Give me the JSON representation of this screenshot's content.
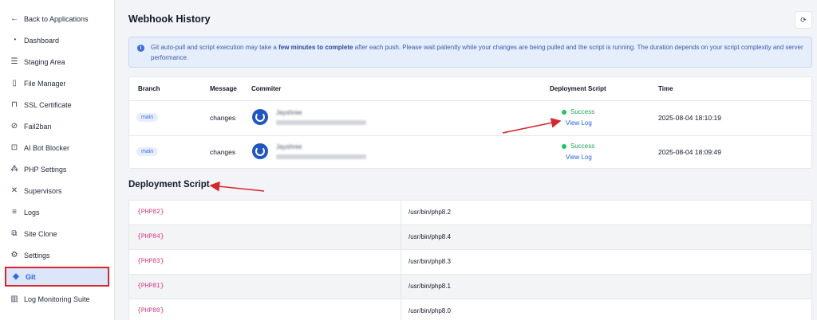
{
  "sidebar": {
    "items": [
      {
        "label": "Back to Applications",
        "icon": "arrow-left-icon",
        "glyph": "←"
      },
      {
        "label": "Dashboard",
        "icon": "gauge-icon",
        "glyph": "◔"
      },
      {
        "label": "Staging Area",
        "icon": "layers-icon",
        "glyph": "☰"
      },
      {
        "label": "File Manager",
        "icon": "file-icon",
        "glyph": "▯"
      },
      {
        "label": "SSL Certificate",
        "icon": "lock-icon",
        "glyph": "⊓"
      },
      {
        "label": "Fail2ban",
        "icon": "ban-icon",
        "glyph": "⊘"
      },
      {
        "label": "AI Bot Blocker",
        "icon": "robot-icon",
        "glyph": "⊡"
      },
      {
        "label": "PHP Settings",
        "icon": "nodes-icon",
        "glyph": "⁂"
      },
      {
        "label": "Supervisors",
        "icon": "tools-icon",
        "glyph": "✕"
      },
      {
        "label": "Logs",
        "icon": "document-icon",
        "glyph": "≡"
      },
      {
        "label": "Site Clone",
        "icon": "copy-icon",
        "glyph": "⧉"
      },
      {
        "label": "Settings",
        "icon": "gear-icon",
        "glyph": "⚙"
      },
      {
        "label": "Git",
        "icon": "git-icon",
        "glyph": "◈"
      },
      {
        "label": "Log Monitoring Suite",
        "icon": "chart-icon",
        "glyph": "▥"
      }
    ]
  },
  "header": {
    "title": "Webhook History",
    "refresh_icon": "refresh-icon",
    "refresh_glyph": "⟳"
  },
  "alert": {
    "before": "Git auto-pull and script execution may take a ",
    "bold": "few minutes to complete",
    "after": " after each push. Please wait patiently while your changes are being pulled and the script is running. The duration depends on your script complexity and server performance."
  },
  "history": {
    "columns": [
      "Branch",
      "Message",
      "Commiter",
      "Deployment Script",
      "Time"
    ],
    "rows": [
      {
        "branch": "main",
        "message": "changes",
        "commiter": "Jayshree",
        "status": "Success",
        "link": "View Log",
        "time": "2025-08-04 18:10:19"
      },
      {
        "branch": "main",
        "message": "changes",
        "commiter": "Jayshree",
        "status": "Success",
        "link": "View Log",
        "time": "2025-08-04 18:09:49"
      }
    ]
  },
  "deployment": {
    "title": "Deployment Script",
    "rows": [
      {
        "var": "{PHP82}",
        "path": "/usr/bin/php8.2"
      },
      {
        "var": "{PHP84}",
        "path": "/usr/bin/php8.4"
      },
      {
        "var": "{PHP83}",
        "path": "/usr/bin/php8.3"
      },
      {
        "var": "{PHP81}",
        "path": "/usr/bin/php8.1"
      },
      {
        "var": "{PHP80}",
        "path": "/usr/bin/php8.0"
      }
    ]
  },
  "colors": {
    "accent": "#2563eb",
    "success": "#22c55e",
    "highlight_border": "#d9262c",
    "annotation_arrow": "#d9262c"
  }
}
